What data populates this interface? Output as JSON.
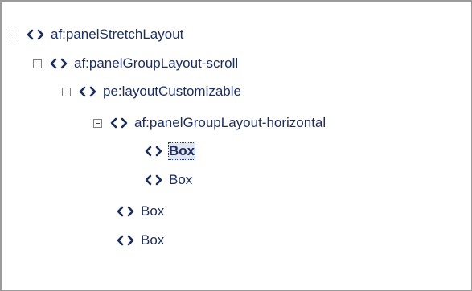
{
  "tree": {
    "nodes": [
      {
        "label": "af:panelStretchLayout",
        "expanded": true,
        "selected": false
      },
      {
        "label": "af:panelGroupLayout-scroll",
        "expanded": true,
        "selected": false
      },
      {
        "label": "pe:layoutCustomizable",
        "expanded": true,
        "selected": false
      },
      {
        "label": "af:panelGroupLayout-horizontal",
        "expanded": true,
        "selected": false
      },
      {
        "label": "Box",
        "expanded": null,
        "selected": true
      },
      {
        "label": "Box",
        "expanded": null,
        "selected": false
      },
      {
        "label": "Box",
        "expanded": null,
        "selected": false
      },
      {
        "label": "Box",
        "expanded": null,
        "selected": false
      }
    ],
    "icon": "tag-brackets-icon",
    "colors": {
      "text": "#1c2d5e",
      "selection_bg": "#e1e6f2",
      "border": "#9a9a9a"
    }
  }
}
